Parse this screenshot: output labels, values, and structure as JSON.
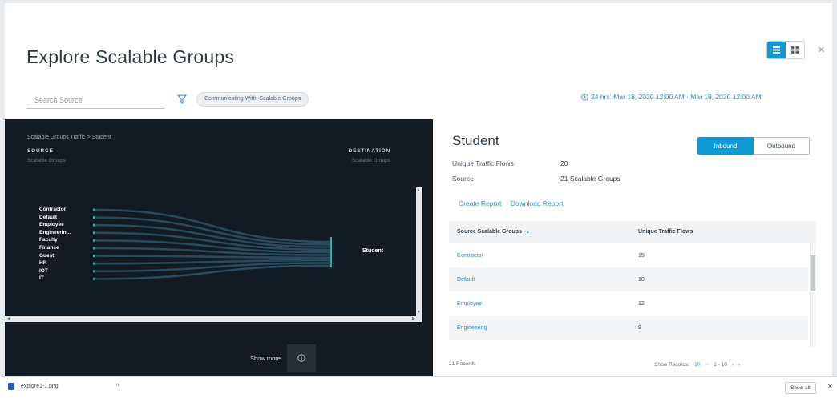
{
  "modal": {
    "title": "Explore Scalable Groups",
    "close_label": "×",
    "view_modes": [
      "list-view-icon",
      "grid-view-icon"
    ]
  },
  "toolbar": {
    "search_placeholder": "Search Source",
    "filter_pill": "Communicating With: Scalable Groups",
    "time_range": "24 hrs: Mar 18, 2020 12:00 AM - Mar 19, 2020 12:00 AM"
  },
  "sankey": {
    "breadcrumb": "Scalable Groups Traffic > Student",
    "source_label": "SOURCE",
    "source_sub": "Scalable Groups",
    "destination_label": "DESTINATION",
    "destination_sub": "Scalable Groups",
    "sources": [
      "Contractor",
      "Default",
      "Employee",
      "Engineerin...",
      "Faculty",
      "Finance",
      "Guest",
      "HR",
      "IOT",
      "IT"
    ],
    "destination": "Student",
    "show_more": "Show more",
    "colors": {
      "background": "#121a24",
      "flow": "#2c4f63",
      "node": "#1fb5b5"
    }
  },
  "detail": {
    "title": "Student",
    "unique_label": "Unique Traffic Flows",
    "unique_value": "20",
    "source_label": "Source",
    "source_value": "21  Scalable Groups",
    "inbound": "Inbound",
    "outbound": "Outbound",
    "create_report": "Create Report",
    "download_report": "Download Report",
    "table": {
      "col1": "Source Scalable Groups",
      "col1_sort": "▲",
      "col2": "Unique Traffic Flows",
      "rows": [
        {
          "group": "Contractor",
          "flows": "15"
        },
        {
          "group": "Default",
          "flows": "18"
        },
        {
          "group": "Employee",
          "flows": "12"
        },
        {
          "group": "Engineering",
          "flows": "9"
        }
      ]
    },
    "records": "21 Records",
    "show_records_label": "Show Records:",
    "show_records_value": "10",
    "page_range": "1 - 10"
  },
  "downloads": {
    "file_name": "explore1-1.png",
    "show_all": "Show all",
    "close": "✕"
  },
  "accent_color": "#0f9ad6"
}
